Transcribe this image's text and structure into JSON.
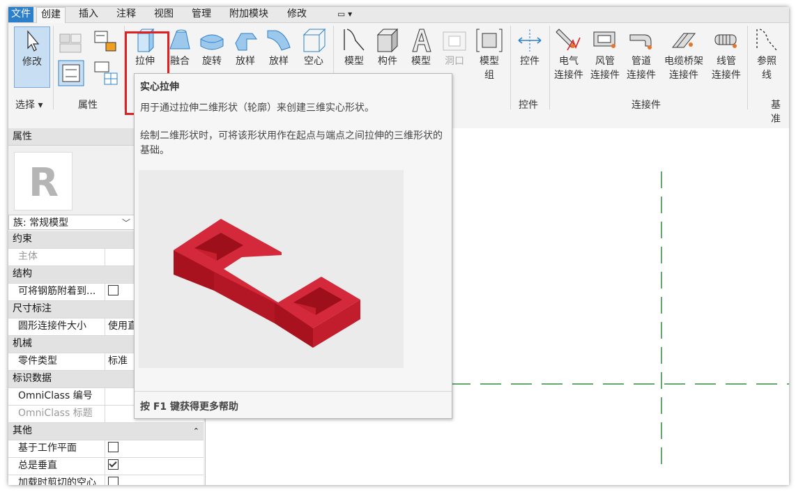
{
  "tabs": [
    "文件",
    "创建",
    "插入",
    "注释",
    "视图",
    "管理",
    "附加模块",
    "修改"
  ],
  "ribbon": {
    "modify": "修改",
    "select_group": "选择",
    "properties_group": "属性",
    "tools": [
      {
        "label": "拉伸"
      },
      {
        "label": "融合"
      },
      {
        "label": "旋转"
      },
      {
        "label": "放样"
      },
      {
        "label": "放样"
      },
      {
        "label": "空心"
      },
      {
        "label": "模型"
      },
      {
        "label": "构件"
      },
      {
        "label": "模型"
      },
      {
        "label": "洞口"
      },
      {
        "label": "模型",
        "label2": "组"
      }
    ],
    "control": "控件",
    "control_group": "控件",
    "connectors": [
      {
        "label": "电气",
        "label2": "连接件"
      },
      {
        "label": "风管",
        "label2": "连接件"
      },
      {
        "label": "管道",
        "label2": "连接件"
      },
      {
        "label": "电缆桥架",
        "label2": "连接件"
      },
      {
        "label": "线管",
        "label2": "连接件"
      }
    ],
    "connector_group": "连接件",
    "ref": {
      "label": "参照",
      "label2": "线"
    },
    "datum_group": "基准"
  },
  "properties": {
    "title": "属性",
    "family": "族: 常规模型",
    "rows": [
      {
        "type": "cat",
        "k": "约束"
      },
      {
        "type": "item",
        "k": "主体",
        "grey": true,
        "v": ""
      },
      {
        "type": "cat",
        "k": "结构"
      },
      {
        "type": "item",
        "k": "可将钢筋附着到...",
        "cb": false
      },
      {
        "type": "cat",
        "k": "尺寸标注"
      },
      {
        "type": "item",
        "k": "圆形连接件大小",
        "v": "使用直"
      },
      {
        "type": "cat",
        "k": "机械"
      },
      {
        "type": "item",
        "k": "零件类型",
        "v": "标准"
      },
      {
        "type": "cat",
        "k": "标识数据"
      },
      {
        "type": "item",
        "k": "OmniClass 编号",
        "v": ""
      },
      {
        "type": "item",
        "k": "OmniClass 标题",
        "grey": true,
        "v": ""
      },
      {
        "type": "cat",
        "k": "其他",
        "collapse": true
      },
      {
        "type": "item",
        "k": "基于工作平面",
        "cb": false
      },
      {
        "type": "item",
        "k": "总是垂直",
        "cb": true
      },
      {
        "type": "item",
        "k": "加载时剪切的空心",
        "cb": false
      }
    ]
  },
  "tooltip": {
    "title": "实心拉伸",
    "line1": "用于通过拉伸二维形状（轮廓）来创建三维实心形状。",
    "para": "绘制二维形状时，可将该形状用作在起点与端点之间拉伸的三维形状的基础。",
    "footer": "按 F1 键获得更多帮助"
  },
  "colors": {
    "accent": "#2c7fc9",
    "highlight": "#e02020",
    "extrusion": "#c41e2e",
    "refplane": "#2f8a3c"
  }
}
